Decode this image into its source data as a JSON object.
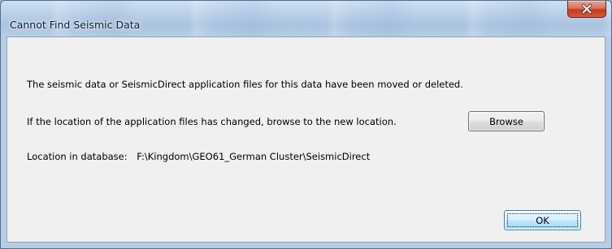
{
  "window": {
    "title": "Cannot Find Seismic Data",
    "close_icon": "close-icon"
  },
  "dialog": {
    "message_moved": "The seismic data or SeismicDirect application files for this data have been moved or deleted.",
    "message_browse": "If the location of the application files has changed, browse to the new location.",
    "location_label": "Location in database:",
    "location_value": "F:\\Kingdom\\GEO61_German Cluster\\SeismicDirect",
    "browse_label": "Browse",
    "ok_label": "OK"
  },
  "colors": {
    "close_button": "#c33a1f",
    "dialog_background": "#f0f0f0",
    "frame_glass": "#a9c3e0"
  }
}
